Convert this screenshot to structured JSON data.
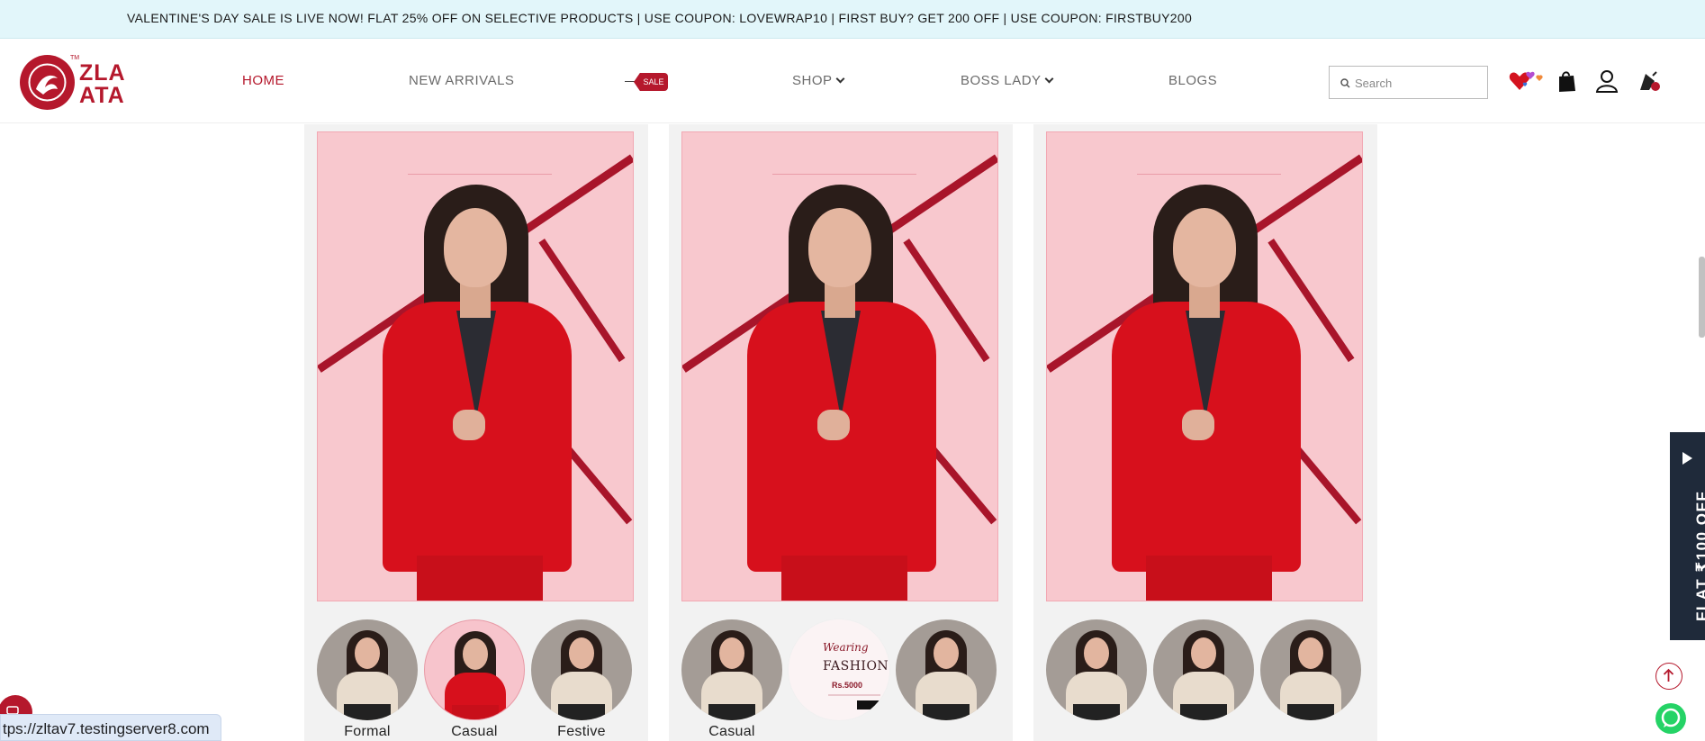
{
  "announcement": "VALENTINE'S DAY SALE IS LIVE NOW! FLAT 25% OFF ON SELECTIVE PRODUCTS | USE COUPON: LOVEWRAP10 | FIRST BUY? GET 200 OFF | USE COUPON: FIRSTBUY200",
  "logo": {
    "line1": "ZLA",
    "line2": "ATA",
    "tm": "TM"
  },
  "nav": {
    "home": "HOME",
    "new_arrivals": "NEW ARRIVALS",
    "sale": "SALE",
    "shop": "SHOP",
    "boss_lady": "BOSS LADY",
    "blogs": "BLOGS"
  },
  "search": {
    "placeholder": "Search"
  },
  "colors": {
    "brand": "#b5182c",
    "announce_bg": "#e2f6fa",
    "card_bg": "#f2f2f2",
    "product_bg": "#f8c8ce",
    "offer_bg": "#1f2a3a"
  },
  "icons": [
    "hearts-icon",
    "shopping-bag-icon",
    "user-icon",
    "cart-icon"
  ],
  "products": [
    {
      "thumbs": [
        {
          "label": "Formal",
          "style": "beige"
        },
        {
          "label": "Casual",
          "style": "pink"
        },
        {
          "label": "Festive",
          "style": "beige"
        }
      ]
    },
    {
      "thumbs": [
        {
          "label": "Casual",
          "style": "beige"
        },
        {
          "label": "",
          "style": "promo"
        },
        {
          "label": "",
          "style": "beige"
        }
      ]
    },
    {
      "thumbs": [
        {
          "label": "",
          "style": "beige"
        },
        {
          "label": "",
          "style": "beige"
        },
        {
          "label": "",
          "style": "beige"
        }
      ]
    }
  ],
  "promo": {
    "line1": "Wearing",
    "line2": "FASHION",
    "line3": "Rs.5000"
  },
  "side_offer": "FLAT ₹100 OFF",
  "status_url": "tps://zltav7.testingserver8.com"
}
